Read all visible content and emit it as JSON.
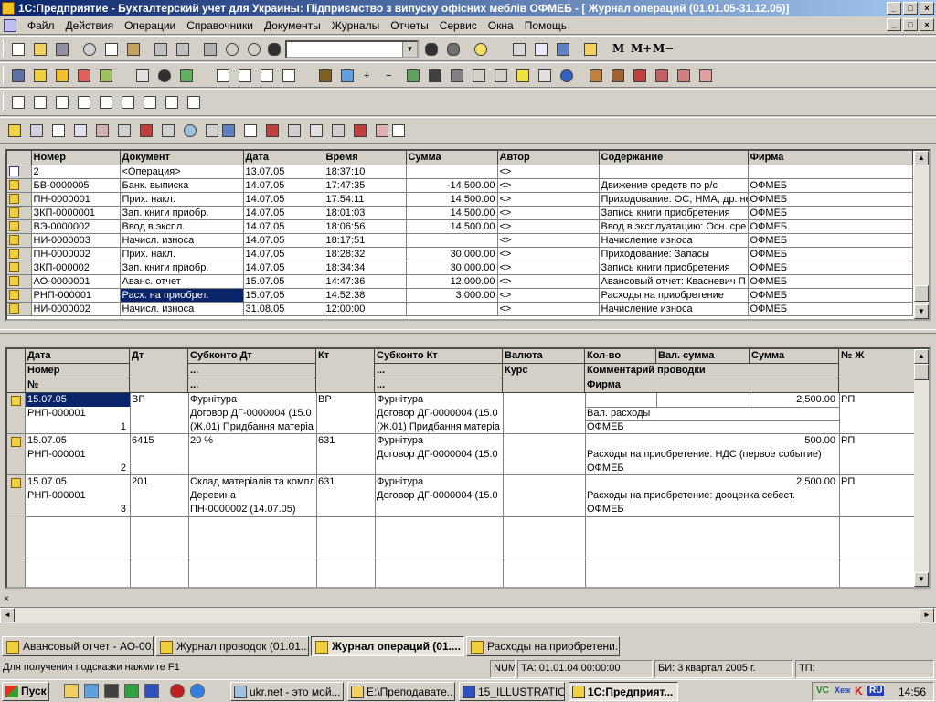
{
  "window": {
    "title": "1С:Предприятие - Бухгалтерский учет для Украины: Підприємство з випуску офісних меблів ОФМЕБ - [ Журнал операций (01.01.05-31.12.05)]",
    "min": "_",
    "max": "□",
    "close": "×"
  },
  "menu": [
    "Файл",
    "Действия",
    "Операции",
    "Справочники",
    "Документы",
    "Журналы",
    "Отчеты",
    "Сервис",
    "Окна",
    "Помощь"
  ],
  "toolbar": {
    "search_value": "",
    "m_label": "M",
    "mplus_label": "M+",
    "mminus_label": "M−"
  },
  "journal": {
    "columns": [
      "Номер",
      "Документ",
      "Дата",
      "Время",
      "Сумма",
      "Автор",
      "Содержание",
      "Фирма"
    ],
    "rows": [
      {
        "icon": "operation-icon",
        "num": "2",
        "doc": "<Операция>",
        "date": "13.07.05",
        "time": "18:37:10",
        "sum": "",
        "author": "<>",
        "content": "",
        "firm": ""
      },
      {
        "icon": "document-icon",
        "num": "БВ-0000005",
        "doc": "Банк. выписка",
        "date": "14.07.05",
        "time": "17:47:35",
        "sum": "-14,500.00",
        "author": "<>",
        "content": "Движение средств по р/с",
        "firm": "ОФМЕБ"
      },
      {
        "icon": "document-icon",
        "num": "ПН-0000001",
        "doc": "Прих. накл.",
        "date": "14.07.05",
        "time": "17:54:11",
        "sum": "14,500.00",
        "author": "<>",
        "content": "Приходование: ОС, НМА, др. не",
        "firm": "ОФМЕБ"
      },
      {
        "icon": "document-icon",
        "num": "ЗКП-0000001",
        "doc": "Зап. книги приобр.",
        "date": "14.07.05",
        "time": "18:01:03",
        "sum": "14,500.00",
        "author": "<>",
        "content": "Запись книги приобретения",
        "firm": "ОФМЕБ"
      },
      {
        "icon": "document-icon",
        "num": "ВЭ-0000002",
        "doc": "Ввод в экспл.",
        "date": "14.07.05",
        "time": "18:06:56",
        "sum": "14,500.00",
        "author": "<>",
        "content": "Ввод в эксплуатацию: Осн. сре",
        "firm": "ОФМЕБ"
      },
      {
        "icon": "document-icon",
        "num": "НИ-0000003",
        "doc": "Начисл. износа",
        "date": "14.07.05",
        "time": "18:17:51",
        "sum": "",
        "author": "<>",
        "content": "Начисление износа",
        "firm": "ОФМЕБ"
      },
      {
        "icon": "document-icon",
        "num": "ПН-0000002",
        "doc": "Прих. накл.",
        "date": "14.07.05",
        "time": "18:28:32",
        "sum": "30,000.00",
        "author": "<>",
        "content": "Приходование: Запасы",
        "firm": "ОФМЕБ"
      },
      {
        "icon": "document-icon",
        "num": "ЗКП-000002",
        "doc": "Зап. книги приобр.",
        "date": "14.07.05",
        "time": "18:34:34",
        "sum": "30,000.00",
        "author": "<>",
        "content": "Запись книги приобретения",
        "firm": "ОФМЕБ"
      },
      {
        "icon": "document-icon",
        "num": "АО-0000001",
        "doc": "Аванс. отчет",
        "date": "15.07.05",
        "time": "14:47:36",
        "sum": "12,000.00",
        "author": "<>",
        "content": "Авансовый отчет: Квасневич П",
        "firm": "ОФМЕБ"
      },
      {
        "icon": "document-icon",
        "num": "РНП-000001",
        "doc": "Расх. на приобрет.",
        "date": "15.07.05",
        "time": "14:52:38",
        "sum": "3,000.00",
        "author": "<>",
        "content": "Расходы на приобретение",
        "firm": "ОФМЕБ",
        "selected": true
      },
      {
        "icon": "document-icon",
        "num": "НИ-0000002",
        "doc": "Начисл. износа",
        "date": "31.08.05",
        "time": "12:00:00",
        "sum": "",
        "author": "<>",
        "content": "Начисление износа",
        "firm": "ОФМЕБ"
      }
    ]
  },
  "entries": {
    "headers": {
      "date": "Дата",
      "number": "Номер",
      "no": "№",
      "dt": "Дт",
      "sub_dt": "Субконто Дт",
      "sub_dt_2": "...",
      "sub_dt_3": "...",
      "kt": "Кт",
      "sub_kt": "Субконто Кт",
      "sub_kt_2": "...",
      "sub_kt_3": "...",
      "currency": "Валюта",
      "rate": "Курс",
      "qty": "Кол-во",
      "val_sum": "Вал. сумма",
      "sum": "Сумма",
      "comment": "Комментарий проводки",
      "firm": "Фирма",
      "journal_no": "№ Ж"
    },
    "rows": [
      {
        "date": "15.07.05",
        "number": "РНП-000001",
        "no": "1",
        "dt": "ВР",
        "sub_dt": [
          "Фурнітура",
          "Договор ДГ-0000004 (15.0",
          "(Ж.01) Придбання матеріа"
        ],
        "kt": "ВР",
        "sub_kt": [
          "Фурнітура",
          "Договор ДГ-0000004 (15.0",
          "(Ж.01) Придбання матеріа"
        ],
        "sum": "2,500.00",
        "comment": "Вал. расходы",
        "firm": "ОФМЕБ",
        "journal": "РП"
      },
      {
        "date": "15.07.05",
        "number": "РНП-000001",
        "no": "2",
        "dt": "6415",
        "sub_dt": [
          "20 %",
          "",
          ""
        ],
        "kt": "631",
        "sub_kt": [
          "Фурнітура",
          "Договор ДГ-0000004 (15.0",
          ""
        ],
        "sum": "500.00",
        "comment": "Расходы на приобретение: НДС (первое событие)",
        "firm": "ОФМЕБ",
        "journal": "РП"
      },
      {
        "date": "15.07.05",
        "number": "РНП-000001",
        "no": "3",
        "dt": "201",
        "sub_dt": [
          "Склад матеріалів та компл",
          "Деревина",
          "ПН-0000002 (14.07.05)"
        ],
        "kt": "631",
        "sub_kt": [
          "Фурнітура",
          "Договор ДГ-0000004 (15.0",
          ""
        ],
        "sum": "2,500.00",
        "comment": "Расходы на приобретение: дооценка себест.",
        "firm": "ОФМЕБ",
        "journal": "РП"
      }
    ]
  },
  "window_tabs": [
    {
      "label": "Авансовый отчет - АО-00...",
      "active": false
    },
    {
      "label": "Журнал проводок (01.01....",
      "active": false
    },
    {
      "label": "Журнал операций (01....",
      "active": true
    },
    {
      "label": "Расходы на приобретени...",
      "active": false
    }
  ],
  "status": {
    "hint": "Для получения подсказки нажмите F1",
    "num": "NUM",
    "ta": "ТА: 01.01.04  00:00:00",
    "bi": "БИ: 3 квартал 2005 г.",
    "tp": "ТП:"
  },
  "taskbar": {
    "start": "Пуск",
    "tasks": [
      {
        "label": "ukr.net - это мой...",
        "active": false
      },
      {
        "label": "E:\\Преподавате...",
        "active": false
      },
      {
        "label": "15_ILLUSTRATIO...",
        "active": false
      },
      {
        "label": "1С:Предприят...",
        "active": true
      }
    ],
    "clock": "14:56",
    "tray": [
      "VC",
      "Хеж",
      "K",
      "RU"
    ]
  }
}
